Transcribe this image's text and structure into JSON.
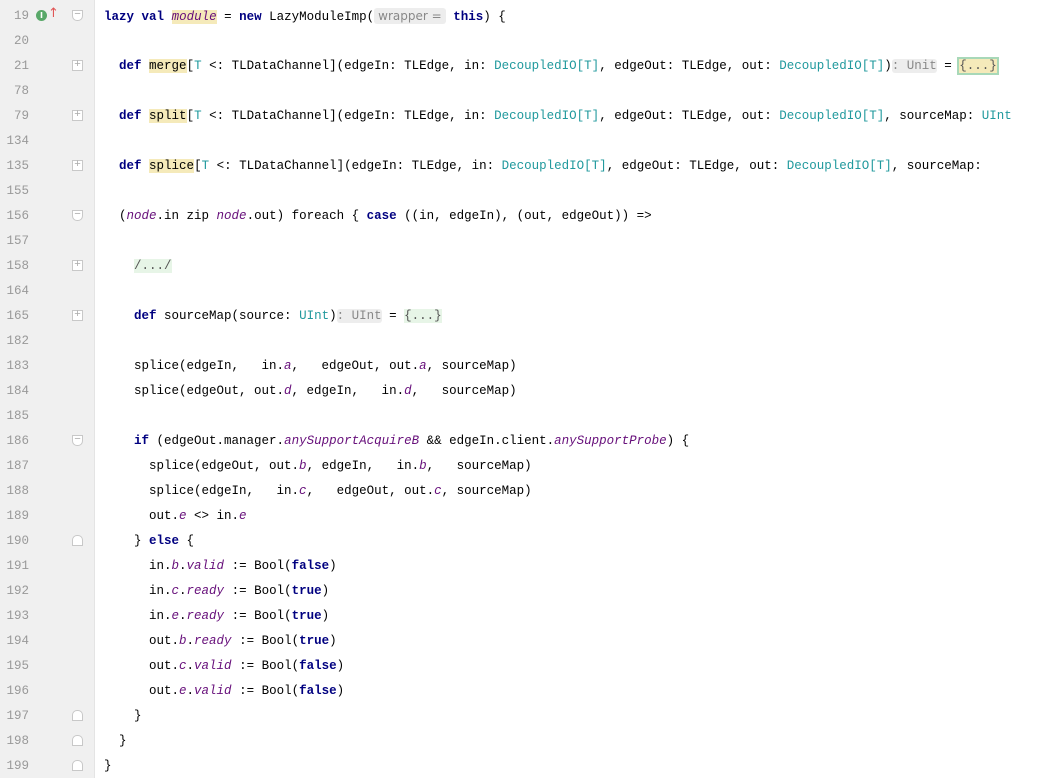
{
  "colors": {
    "keyword": "#000080",
    "type": "#20999d",
    "italic_field": "#660e7a",
    "highlight": "#f5eaba",
    "gutter": "#f0f0f0"
  },
  "gutter_icons": {
    "implements_marker": "I",
    "override_arrow": "↑"
  },
  "lines": [
    {
      "n": "19",
      "fold": "start",
      "marker": true,
      "tokens": [
        [
          "lazy",
          "kw"
        ],
        [
          " ",
          ""
        ],
        [
          "val",
          "kw"
        ],
        [
          " ",
          ""
        ],
        [
          "module",
          "hlit"
        ],
        [
          " = ",
          ""
        ],
        [
          "new",
          "kw"
        ],
        [
          " LazyModuleImp(",
          ""
        ],
        [
          "wrapper =",
          "hintp"
        ],
        [
          " ",
          ""
        ],
        [
          "this",
          "kw"
        ],
        [
          ") {",
          ""
        ]
      ]
    },
    {
      "n": "20",
      "tokens": []
    },
    {
      "n": "21",
      "fold": "plus",
      "tokens": [
        [
          "  ",
          ""
        ],
        [
          "def",
          "kw"
        ],
        [
          " ",
          ""
        ],
        [
          "merge",
          "hl"
        ],
        [
          "[",
          ""
        ],
        [
          "T",
          "ty"
        ],
        [
          " <: TLDataChannel](edgeIn: TLEdge, in: ",
          ""
        ],
        [
          "DecoupledIO[T]",
          "ty"
        ],
        [
          ", edgeOut: TLEdge, out: ",
          ""
        ],
        [
          "DecoupledIO[T]",
          "ty"
        ],
        [
          ")",
          ""
        ],
        [
          ": Unit",
          "hint"
        ],
        [
          " = ",
          ""
        ],
        [
          "{...}",
          "fbsel"
        ]
      ]
    },
    {
      "n": "78",
      "tokens": []
    },
    {
      "n": "79",
      "fold": "plus",
      "tokens": [
        [
          "  ",
          ""
        ],
        [
          "def",
          "kw"
        ],
        [
          " ",
          ""
        ],
        [
          "split",
          "hl"
        ],
        [
          "[",
          ""
        ],
        [
          "T",
          "ty"
        ],
        [
          " <: TLDataChannel](edgeIn: TLEdge, in: ",
          ""
        ],
        [
          "DecoupledIO[T]",
          "ty"
        ],
        [
          ", edgeOut: TLEdge, out: ",
          ""
        ],
        [
          "DecoupledIO[T]",
          "ty"
        ],
        [
          ", sourceMap: ",
          ""
        ],
        [
          "UInt",
          "ty"
        ]
      ]
    },
    {
      "n": "134",
      "tokens": []
    },
    {
      "n": "135",
      "fold": "plus",
      "tokens": [
        [
          "  ",
          ""
        ],
        [
          "def",
          "kw"
        ],
        [
          " ",
          ""
        ],
        [
          "splice",
          "hl"
        ],
        [
          "[",
          ""
        ],
        [
          "T",
          "ty"
        ],
        [
          " <: TLDataChannel](edgeIn: TLEdge, in: ",
          ""
        ],
        [
          "DecoupledIO[T]",
          "ty"
        ],
        [
          ", edgeOut: TLEdge, out: ",
          ""
        ],
        [
          "DecoupledIO[T]",
          "ty"
        ],
        [
          ", sourceMap: ",
          ""
        ]
      ]
    },
    {
      "n": "155",
      "tokens": []
    },
    {
      "n": "156",
      "fold": "start",
      "tokens": [
        [
          "  (",
          ""
        ],
        [
          "node",
          "it"
        ],
        [
          ".in zip ",
          ""
        ],
        [
          "node",
          "it"
        ],
        [
          ".out) foreach { ",
          ""
        ],
        [
          "case",
          "kw"
        ],
        [
          " ((in, edgeIn), (out, edgeOut)) =>",
          ""
        ]
      ]
    },
    {
      "n": "157",
      "tokens": []
    },
    {
      "n": "158",
      "fold": "plus",
      "tokens": [
        [
          "    ",
          ""
        ],
        [
          "/.../",
          "fb"
        ]
      ]
    },
    {
      "n": "164",
      "tokens": []
    },
    {
      "n": "165",
      "fold": "plus",
      "tokens": [
        [
          "    ",
          ""
        ],
        [
          "def",
          "kw"
        ],
        [
          " sourceMap(source: ",
          ""
        ],
        [
          "UInt",
          "ty"
        ],
        [
          ")",
          ""
        ],
        [
          ": UInt",
          "hint"
        ],
        [
          " = ",
          ""
        ],
        [
          "{...}",
          "fb"
        ]
      ]
    },
    {
      "n": "182",
      "tokens": []
    },
    {
      "n": "183",
      "tokens": [
        [
          "    splice(edgeIn,   in.",
          ""
        ],
        [
          "a",
          "it"
        ],
        [
          ",   edgeOut, out.",
          ""
        ],
        [
          "a",
          "it"
        ],
        [
          ", sourceMap)",
          ""
        ]
      ]
    },
    {
      "n": "184",
      "tokens": [
        [
          "    splice(edgeOut, out.",
          ""
        ],
        [
          "d",
          "it"
        ],
        [
          ", edgeIn,   in.",
          ""
        ],
        [
          "d",
          "it"
        ],
        [
          ",   sourceMap)",
          ""
        ]
      ]
    },
    {
      "n": "185",
      "tokens": []
    },
    {
      "n": "186",
      "fold": "start",
      "tokens": [
        [
          "    ",
          ""
        ],
        [
          "if",
          "kw"
        ],
        [
          " (edgeOut.manager.",
          ""
        ],
        [
          "anySupportAcquireB",
          "it"
        ],
        [
          " && edgeIn.client.",
          ""
        ],
        [
          "anySupportProbe",
          "it"
        ],
        [
          ") {",
          ""
        ]
      ]
    },
    {
      "n": "187",
      "tokens": [
        [
          "      splice(edgeOut, out.",
          ""
        ],
        [
          "b",
          "it"
        ],
        [
          ", edgeIn,   in.",
          ""
        ],
        [
          "b",
          "it"
        ],
        [
          ",   sourceMap)",
          ""
        ]
      ]
    },
    {
      "n": "188",
      "tokens": [
        [
          "      splice(edgeIn,   in.",
          ""
        ],
        [
          "c",
          "it"
        ],
        [
          ",   edgeOut, out.",
          ""
        ],
        [
          "c",
          "it"
        ],
        [
          ", sourceMap)",
          ""
        ]
      ]
    },
    {
      "n": "189",
      "tokens": [
        [
          "      out.",
          ""
        ],
        [
          "e",
          "it"
        ],
        [
          " <> in.",
          ""
        ],
        [
          "e",
          "it"
        ]
      ]
    },
    {
      "n": "190",
      "fold": "end",
      "tokens": [
        [
          "    } ",
          ""
        ],
        [
          "else",
          "kw"
        ],
        [
          " {",
          ""
        ]
      ]
    },
    {
      "n": "191",
      "tokens": [
        [
          "      in.",
          ""
        ],
        [
          "b",
          "it"
        ],
        [
          ".",
          ""
        ],
        [
          "valid",
          "it"
        ],
        [
          " := Bool(",
          ""
        ],
        [
          "false",
          "kw"
        ],
        [
          ")",
          ""
        ]
      ]
    },
    {
      "n": "192",
      "tokens": [
        [
          "      in.",
          ""
        ],
        [
          "c",
          "it"
        ],
        [
          ".",
          ""
        ],
        [
          "ready",
          "it"
        ],
        [
          " := Bool(",
          ""
        ],
        [
          "true",
          "kw"
        ],
        [
          ")",
          ""
        ]
      ]
    },
    {
      "n": "193",
      "tokens": [
        [
          "      in.",
          ""
        ],
        [
          "e",
          "it"
        ],
        [
          ".",
          ""
        ],
        [
          "ready",
          "it"
        ],
        [
          " := Bool(",
          ""
        ],
        [
          "true",
          "kw"
        ],
        [
          ")",
          ""
        ]
      ]
    },
    {
      "n": "194",
      "tokens": [
        [
          "      out.",
          ""
        ],
        [
          "b",
          "it"
        ],
        [
          ".",
          ""
        ],
        [
          "ready",
          "it"
        ],
        [
          " := Bool(",
          ""
        ],
        [
          "true",
          "kw"
        ],
        [
          ")",
          ""
        ]
      ]
    },
    {
      "n": "195",
      "tokens": [
        [
          "      out.",
          ""
        ],
        [
          "c",
          "it"
        ],
        [
          ".",
          ""
        ],
        [
          "valid",
          "it"
        ],
        [
          " := Bool(",
          ""
        ],
        [
          "false",
          "kw"
        ],
        [
          ")",
          ""
        ]
      ]
    },
    {
      "n": "196",
      "tokens": [
        [
          "      out.",
          ""
        ],
        [
          "e",
          "it"
        ],
        [
          ".",
          ""
        ],
        [
          "valid",
          "it"
        ],
        [
          " := Bool(",
          ""
        ],
        [
          "false",
          "kw"
        ],
        [
          ")",
          ""
        ]
      ]
    },
    {
      "n": "197",
      "fold": "end",
      "tokens": [
        [
          "    }",
          ""
        ]
      ]
    },
    {
      "n": "198",
      "fold": "end",
      "tokens": [
        [
          "  }",
          ""
        ]
      ]
    },
    {
      "n": "199",
      "fold": "end",
      "tokens": [
        [
          "}",
          ""
        ]
      ]
    }
  ]
}
